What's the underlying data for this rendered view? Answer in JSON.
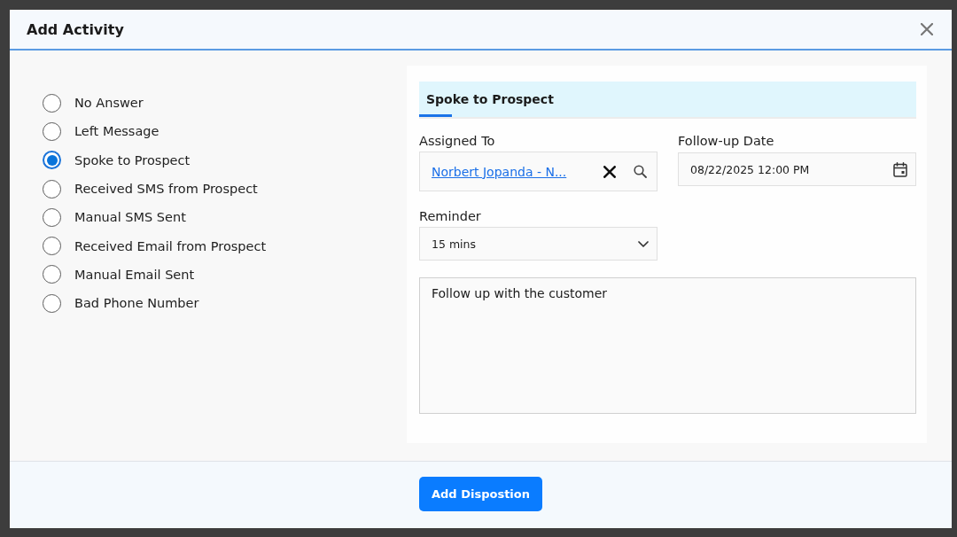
{
  "dialog": {
    "title": "Add Activity"
  },
  "dispositions": [
    {
      "label": "No Answer",
      "selected": false
    },
    {
      "label": "Left Message",
      "selected": false
    },
    {
      "label": "Spoke to Prospect",
      "selected": true
    },
    {
      "label": "Received SMS from Prospect",
      "selected": false
    },
    {
      "label": "Manual SMS Sent",
      "selected": false
    },
    {
      "label": "Received Email from Prospect",
      "selected": false
    },
    {
      "label": "Manual Email Sent",
      "selected": false
    },
    {
      "label": "Bad Phone Number",
      "selected": false
    }
  ],
  "detail": {
    "tabs": [
      {
        "label": "Spoke to Prospect",
        "selected": true
      }
    ],
    "assigned_to": {
      "label": "Assigned To",
      "value": "Norbert Jopanda - N..."
    },
    "follow_up_date": {
      "label": "Follow-up Date",
      "value": "08/22/2025 12:00 PM"
    },
    "reminder": {
      "label": "Reminder",
      "value": "15 mins"
    },
    "notes": {
      "value": "Follow up with the customer"
    }
  },
  "footer": {
    "buttons": [
      {
        "label": "Add Dispostion"
      }
    ]
  }
}
